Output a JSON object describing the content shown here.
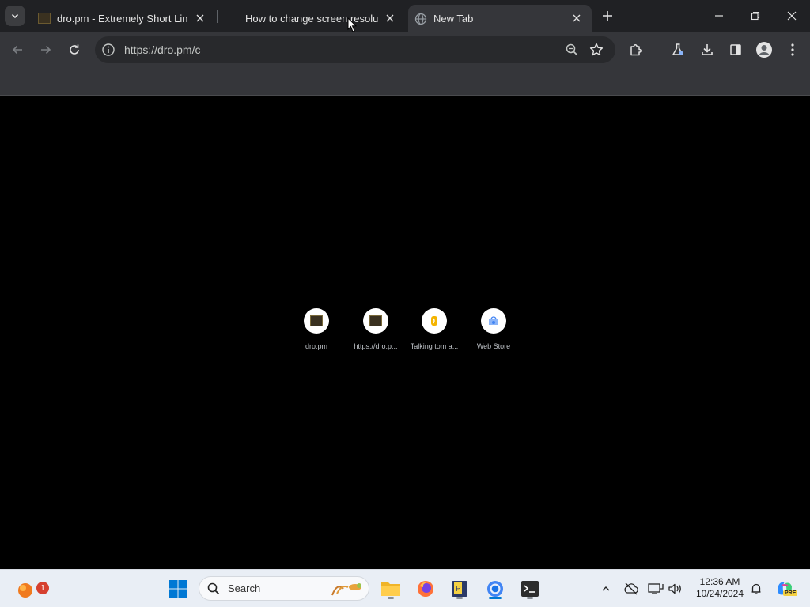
{
  "tabs": [
    {
      "title": "dro.pm - Extremely Short Links",
      "active": false
    },
    {
      "title": "How to change screen resolution",
      "active": false
    },
    {
      "title": "New Tab",
      "active": true
    }
  ],
  "toolbar": {
    "url": "https://dro.pm/c"
  },
  "shortcuts": [
    {
      "label": "dro.pm",
      "icon": "dro-favicon"
    },
    {
      "label": "https://dro.p...",
      "icon": "dro-favicon"
    },
    {
      "label": "Talking tom a...",
      "icon": "talking-tom-icon"
    },
    {
      "label": "Web Store",
      "icon": "web-store-icon"
    }
  ],
  "taskbar": {
    "search_placeholder": "Search",
    "notification_badge": "1",
    "clock_time": "12:36 AM",
    "clock_date": "10/24/2024",
    "copilot_badge": "PRE"
  },
  "colors": {
    "tab_strip": "#202124",
    "toolbar": "#35363a",
    "content_bg": "#000000",
    "taskbar": "#e9eef5",
    "accent": "#0078d4"
  }
}
